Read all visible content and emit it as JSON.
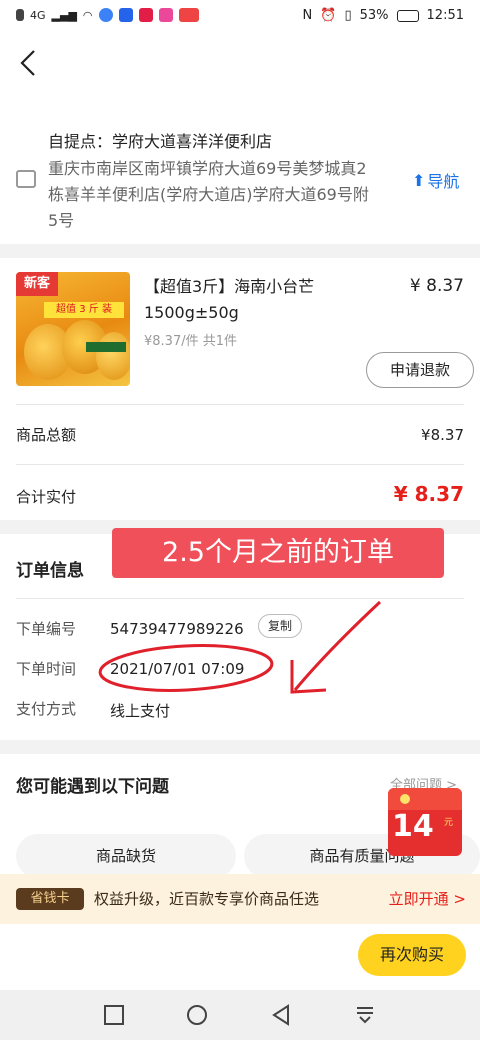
{
  "status_bar": {
    "left_text": "4G",
    "battery": "53%",
    "time": "12:51"
  },
  "pickup": {
    "title": "自提点：学府大道喜洋洋便利店",
    "address": "重庆市南岸区南坪镇学府大道69号美梦城真2栋喜羊羊便利店(学府大道店)学府大道69号附5号",
    "navigate_label": "导航"
  },
  "product": {
    "image_tag": "新客",
    "image_banner": "超值 3 斤 装",
    "name": "【超值3斤】海南小台芒1500g±50g",
    "price": "¥ 8.37",
    "unit_info": "¥8.37/件   共1件",
    "refund_label": "申请退款"
  },
  "summary": {
    "goods_total_label": "商品总额",
    "goods_total_value": "¥8.37",
    "paid_label": "合计实付",
    "paid_value": "¥ 8.37"
  },
  "order_info": {
    "title": "订单信息",
    "annotation": "2.5个月之前的订单",
    "rows": [
      {
        "label": "下单编号",
        "value": "54739477989226"
      },
      {
        "label": "下单时间",
        "value": "2021/07/01 07:09"
      },
      {
        "label": "支付方式",
        "value": "线上支付"
      }
    ],
    "copy_label": "复制"
  },
  "problems": {
    "title": "您可能遇到以下问题",
    "all_label": "全部问题 >",
    "chips": [
      "商品缺货",
      "商品有质量问题"
    ],
    "red_packet_amount": "14",
    "red_packet_unit": "元"
  },
  "promo_bar": {
    "badge": "省钱卡",
    "text": "权益升级，近百款专享价商品任选",
    "action": "立即开通 >"
  },
  "bottom": {
    "rebuy_label": "再次购买"
  },
  "colors": {
    "accent_red": "#e5201b",
    "yellow_button": "#ffd21f",
    "link_blue": "#1a73e8"
  }
}
